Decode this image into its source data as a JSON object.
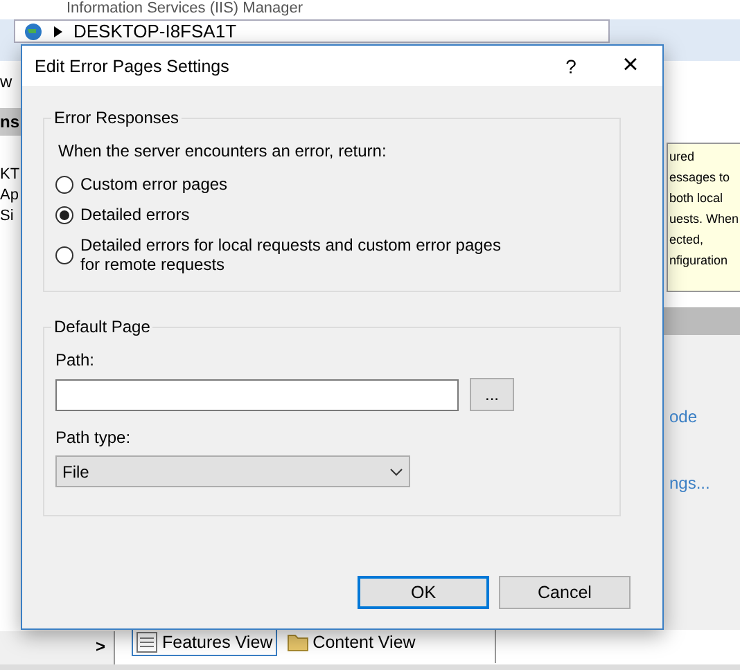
{
  "app": {
    "title": "Information Services (IIS) Manager",
    "address": "DESKTOP-I8FSA1T",
    "menu_fragment": "w",
    "left_header": "ns",
    "tree": [
      "KT",
      "Ap",
      "Si"
    ],
    "info_lines": [
      "ured",
      "essages to",
      "both local",
      "uests. When",
      "ected,",
      "nfiguration"
    ],
    "actions": [
      "ode",
      "ngs..."
    ],
    "scroll_arrow": ">",
    "view_tabs": [
      {
        "label": "Features View",
        "selected": true
      },
      {
        "label": "Content View",
        "selected": false
      }
    ]
  },
  "dialog": {
    "title": "Edit Error Pages Settings",
    "help": "?",
    "close": "×",
    "error_responses": {
      "legend": "Error Responses",
      "prompt": "When the server encounters an error, return:",
      "options": [
        {
          "label": "Custom error pages",
          "selected": false
        },
        {
          "label": "Detailed errors",
          "selected": true
        },
        {
          "label": "Detailed errors for local requests and custom error pages for remote requests",
          "selected": false
        }
      ]
    },
    "default_page": {
      "legend": "Default Page",
      "path_label": "Path:",
      "browse": "...",
      "path_type_label": "Path type:",
      "path_type": "File"
    },
    "buttons": [
      {
        "label": "OK",
        "default": true
      },
      {
        "label": "Cancel",
        "default": false
      }
    ]
  }
}
